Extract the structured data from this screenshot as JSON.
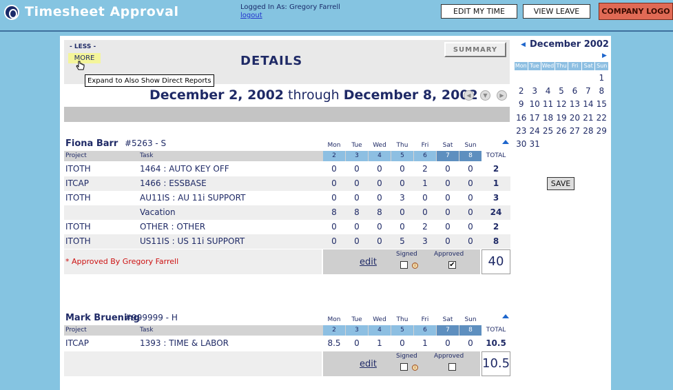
{
  "header": {
    "app_title": "Timesheet Approval",
    "logged_in_label": "Logged In As: Gregory Farrell",
    "logout_label": "logout",
    "edit_my_time": "EDIT MY TIME",
    "view_leave": "VIEW LEAVE",
    "company_logo": "COMPANY LOGO"
  },
  "details": {
    "less_label": "- LESS -",
    "more_label": "MORE",
    "tooltip": "Expand to Also Show Direct Reports",
    "title": "DETAILS",
    "summary_button": "SUMMARY",
    "range_start": "December 2, 2002",
    "range_through": " through ",
    "range_end": "December 8, 2002"
  },
  "calendar": {
    "title": "December 2002",
    "day_names": [
      "Mon",
      "Tue",
      "Wed",
      "Thu",
      "Fri",
      "Sat",
      "Sun"
    ],
    "dates": [
      "",
      "",
      "",
      "",
      "",
      "",
      "1",
      "2",
      "3",
      "4",
      "5",
      "6",
      "7",
      "8",
      "9",
      "10",
      "11",
      "12",
      "13",
      "14",
      "15",
      "16",
      "17",
      "18",
      "19",
      "20",
      "21",
      "22",
      "23",
      "24",
      "25",
      "26",
      "27",
      "28",
      "29",
      "30",
      "31"
    ]
  },
  "save_button": "SAVE",
  "columns": {
    "project": "Project",
    "task": "Task",
    "total": "TOTAL",
    "days": [
      "Mon",
      "Tue",
      "Wed",
      "Thu",
      "Fri",
      "Sat",
      "Sun"
    ],
    "day_numbers": [
      "2",
      "3",
      "4",
      "5",
      "6",
      "7",
      "8"
    ]
  },
  "employees": [
    {
      "name": "Fiona Barr",
      "id": "#5263 - S",
      "rows": [
        {
          "project": "ITOTH",
          "task": "1464 : AUTO KEY OFF",
          "hours": [
            "0",
            "0",
            "0",
            "0",
            "2",
            "0",
            "0"
          ],
          "total": "2"
        },
        {
          "project": "ITCAP",
          "task": "1466 : ESSBASE",
          "hours": [
            "0",
            "0",
            "0",
            "0",
            "1",
            "0",
            "0"
          ],
          "total": "1"
        },
        {
          "project": "ITOTH",
          "task": "AU11IS : AU 11i SUPPORT",
          "hours": [
            "0",
            "0",
            "0",
            "3",
            "0",
            "0",
            "0"
          ],
          "total": "3"
        },
        {
          "project": "",
          "task": "Vacation",
          "hours": [
            "8",
            "8",
            "8",
            "0",
            "0",
            "0",
            "0"
          ],
          "total": "24"
        },
        {
          "project": "ITOTH",
          "task": "OTHER : OTHER",
          "hours": [
            "0",
            "0",
            "0",
            "0",
            "2",
            "0",
            "0"
          ],
          "total": "2"
        },
        {
          "project": "ITOTH",
          "task": "US11IS : US 11i SUPPORT",
          "hours": [
            "0",
            "0",
            "0",
            "5",
            "3",
            "0",
            "0"
          ],
          "total": "8"
        }
      ],
      "note": "* Approved By Gregory Farrell",
      "edit_label": "edit",
      "signed_label": "Signed",
      "approved_label": "Approved",
      "signed_checked": false,
      "approved_checked": true,
      "grand_total": "40"
    },
    {
      "name": "Mark Bruening",
      "id": "#999999 - H",
      "rows": [
        {
          "project": "ITCAP",
          "task": "1393 : TIME & LABOR",
          "hours": [
            "8.5",
            "0",
            "1",
            "0",
            "1",
            "0",
            "0"
          ],
          "total": "10.5"
        }
      ],
      "note": "",
      "edit_label": "edit",
      "signed_label": "Signed",
      "approved_label": "Approved",
      "signed_checked": false,
      "approved_checked": false,
      "grand_total": "10.5"
    }
  ]
}
